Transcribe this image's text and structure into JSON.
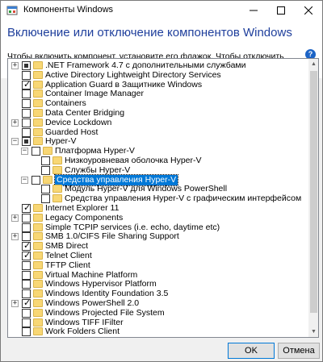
{
  "window": {
    "title": "Компоненты Windows"
  },
  "header": {
    "heading": "Включение или отключение компонентов Windows",
    "description": "Чтобы включить компонент, установите его флажок. Чтобы отключить компонент, снимите его флажок. Затененный флажок означает, что компонент включен частично.",
    "help": "?"
  },
  "tree": {
    "items": [
      {
        "label": ".NET Framework 4.7 с дополнительными службами",
        "level": 0,
        "expander": "+",
        "state": "partial"
      },
      {
        "label": "Active Directory Lightweight Directory Services",
        "level": 0,
        "expander": "",
        "state": "unchecked"
      },
      {
        "label": "Application Guard в Защитнике Windows",
        "level": 0,
        "expander": "",
        "state": "checked"
      },
      {
        "label": "Container Image Manager",
        "level": 0,
        "expander": "",
        "state": "unchecked"
      },
      {
        "label": "Containers",
        "level": 0,
        "expander": "",
        "state": "unchecked"
      },
      {
        "label": "Data Center Bridging",
        "level": 0,
        "expander": "",
        "state": "unchecked"
      },
      {
        "label": "Device Lockdown",
        "level": 0,
        "expander": "+",
        "state": "unchecked"
      },
      {
        "label": "Guarded Host",
        "level": 0,
        "expander": "",
        "state": "unchecked"
      },
      {
        "label": "Hyper-V",
        "level": 0,
        "expander": "−",
        "state": "partial"
      },
      {
        "label": "Платформа Hyper-V",
        "level": 1,
        "expander": "−",
        "state": "unchecked"
      },
      {
        "label": "Низкоуровневая оболочка Hyper-V",
        "level": 2,
        "expander": "",
        "state": "unchecked"
      },
      {
        "label": "Службы Hyper-V",
        "level": 2,
        "expander": "",
        "state": "unchecked"
      },
      {
        "label": "Средства управления Hyper-V",
        "level": 1,
        "expander": "−",
        "state": "unchecked",
        "selected": true
      },
      {
        "label": "Модуль Hyper-V для Windows PowerShell",
        "level": 2,
        "expander": "",
        "state": "unchecked"
      },
      {
        "label": "Средства управления Hyper-V с графическим интерфейсом",
        "level": 2,
        "expander": "",
        "state": "unchecked"
      },
      {
        "label": "Internet Explorer 11",
        "level": 0,
        "expander": "",
        "state": "checked"
      },
      {
        "label": "Legacy Components",
        "level": 0,
        "expander": "+",
        "state": "unchecked"
      },
      {
        "label": "Simple TCPIP services (i.e. echo, daytime etc)",
        "level": 0,
        "expander": "",
        "state": "unchecked"
      },
      {
        "label": "SMB 1.0/CIFS File Sharing Support",
        "level": 0,
        "expander": "+",
        "state": "unchecked"
      },
      {
        "label": "SMB Direct",
        "level": 0,
        "expander": "",
        "state": "checked"
      },
      {
        "label": "Telnet Client",
        "level": 0,
        "expander": "",
        "state": "checked"
      },
      {
        "label": "TFTP Client",
        "level": 0,
        "expander": "",
        "state": "unchecked"
      },
      {
        "label": "Virtual Machine Platform",
        "level": 0,
        "expander": "",
        "state": "unchecked"
      },
      {
        "label": "Windows Hypervisor Platform",
        "level": 0,
        "expander": "",
        "state": "unchecked"
      },
      {
        "label": "Windows Identity Foundation 3.5",
        "level": 0,
        "expander": "",
        "state": "unchecked"
      },
      {
        "label": "Windows PowerShell 2.0",
        "level": 0,
        "expander": "+",
        "state": "checked"
      },
      {
        "label": "Windows Projected File System",
        "level": 0,
        "expander": "",
        "state": "unchecked"
      },
      {
        "label": "Windows TIFF IFilter",
        "level": 0,
        "expander": "",
        "state": "unchecked"
      },
      {
        "label": "Work Folders Client",
        "level": 0,
        "expander": "",
        "state": "unchecked"
      }
    ]
  },
  "buttons": {
    "ok": "OK",
    "cancel": "Отмена"
  },
  "colors": {
    "heading": "#1f3f9c",
    "selection": "#0078d7",
    "folder": "#f8d775"
  }
}
